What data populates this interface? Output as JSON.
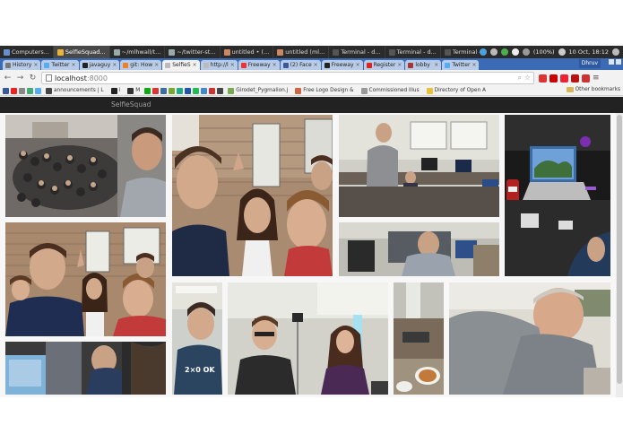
{
  "os_bar": {
    "tasks": [
      "Computers...",
      "SelfieSquad...",
      "~/mlhwall/t...",
      "~/twitter-st...",
      "untitled • (...",
      "untitled (ml...",
      "Terminal - d...",
      "Terminal - d...",
      "Terminal - d..."
    ],
    "battery": "(100%)",
    "clock": "10 Oct, 18:12"
  },
  "tabs": [
    "History",
    "Twitter",
    "javaguy",
    "git: How",
    "SelfieS",
    "http://l",
    "Freeway",
    "(2) Face",
    "Freeway",
    "Register",
    "lobby",
    "Twitter"
  ],
  "profile_name": "Dhruv",
  "address_bar": {
    "host": "localhost",
    "port": ":8000"
  },
  "bookmarks": [
    "announcements | L",
    "i",
    "M",
    "Girodet_Pygmalion.j",
    "Free Logo Design &",
    "Commissioned Illus",
    "Directory of Open A"
  ],
  "other_bookmarks": "Other bookmarks",
  "app": {
    "brand": "SelfieSquad"
  },
  "gallery": {
    "shirt_text": "2×0 OK"
  },
  "colors": {
    "os_bar": "#2b2b2b",
    "tab_strip": "#3c6bb6",
    "toolbar": "#f2f2f2",
    "app_navbar": "#222222",
    "brand_text": "#9d9d9d",
    "page_bg": "#f7f7f7"
  }
}
